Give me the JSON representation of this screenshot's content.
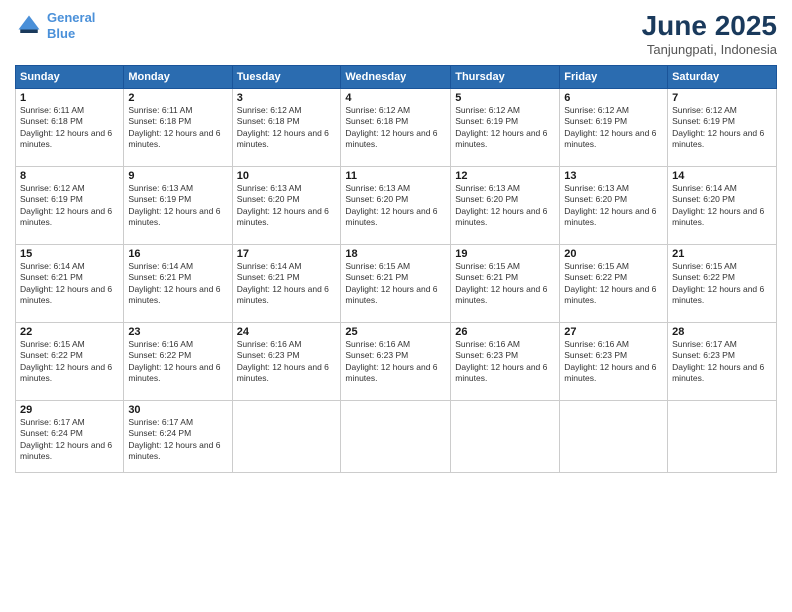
{
  "logo": {
    "line1": "General",
    "line2": "Blue"
  },
  "title": "June 2025",
  "subtitle": "Tanjungpati, Indonesia",
  "days_of_week": [
    "Sunday",
    "Monday",
    "Tuesday",
    "Wednesday",
    "Thursday",
    "Friday",
    "Saturday"
  ],
  "weeks": [
    [
      {
        "day": "1",
        "sunrise": "6:11 AM",
        "sunset": "6:18 PM",
        "daylight": "12 hours and 6 minutes."
      },
      {
        "day": "2",
        "sunrise": "6:11 AM",
        "sunset": "6:18 PM",
        "daylight": "12 hours and 6 minutes."
      },
      {
        "day": "3",
        "sunrise": "6:12 AM",
        "sunset": "6:18 PM",
        "daylight": "12 hours and 6 minutes."
      },
      {
        "day": "4",
        "sunrise": "6:12 AM",
        "sunset": "6:18 PM",
        "daylight": "12 hours and 6 minutes."
      },
      {
        "day": "5",
        "sunrise": "6:12 AM",
        "sunset": "6:19 PM",
        "daylight": "12 hours and 6 minutes."
      },
      {
        "day": "6",
        "sunrise": "6:12 AM",
        "sunset": "6:19 PM",
        "daylight": "12 hours and 6 minutes."
      },
      {
        "day": "7",
        "sunrise": "6:12 AM",
        "sunset": "6:19 PM",
        "daylight": "12 hours and 6 minutes."
      }
    ],
    [
      {
        "day": "8",
        "sunrise": "6:12 AM",
        "sunset": "6:19 PM",
        "daylight": "12 hours and 6 minutes."
      },
      {
        "day": "9",
        "sunrise": "6:13 AM",
        "sunset": "6:19 PM",
        "daylight": "12 hours and 6 minutes."
      },
      {
        "day": "10",
        "sunrise": "6:13 AM",
        "sunset": "6:20 PM",
        "daylight": "12 hours and 6 minutes."
      },
      {
        "day": "11",
        "sunrise": "6:13 AM",
        "sunset": "6:20 PM",
        "daylight": "12 hours and 6 minutes."
      },
      {
        "day": "12",
        "sunrise": "6:13 AM",
        "sunset": "6:20 PM",
        "daylight": "12 hours and 6 minutes."
      },
      {
        "day": "13",
        "sunrise": "6:13 AM",
        "sunset": "6:20 PM",
        "daylight": "12 hours and 6 minutes."
      },
      {
        "day": "14",
        "sunrise": "6:14 AM",
        "sunset": "6:20 PM",
        "daylight": "12 hours and 6 minutes."
      }
    ],
    [
      {
        "day": "15",
        "sunrise": "6:14 AM",
        "sunset": "6:21 PM",
        "daylight": "12 hours and 6 minutes."
      },
      {
        "day": "16",
        "sunrise": "6:14 AM",
        "sunset": "6:21 PM",
        "daylight": "12 hours and 6 minutes."
      },
      {
        "day": "17",
        "sunrise": "6:14 AM",
        "sunset": "6:21 PM",
        "daylight": "12 hours and 6 minutes."
      },
      {
        "day": "18",
        "sunrise": "6:15 AM",
        "sunset": "6:21 PM",
        "daylight": "12 hours and 6 minutes."
      },
      {
        "day": "19",
        "sunrise": "6:15 AM",
        "sunset": "6:21 PM",
        "daylight": "12 hours and 6 minutes."
      },
      {
        "day": "20",
        "sunrise": "6:15 AM",
        "sunset": "6:22 PM",
        "daylight": "12 hours and 6 minutes."
      },
      {
        "day": "21",
        "sunrise": "6:15 AM",
        "sunset": "6:22 PM",
        "daylight": "12 hours and 6 minutes."
      }
    ],
    [
      {
        "day": "22",
        "sunrise": "6:15 AM",
        "sunset": "6:22 PM",
        "daylight": "12 hours and 6 minutes."
      },
      {
        "day": "23",
        "sunrise": "6:16 AM",
        "sunset": "6:22 PM",
        "daylight": "12 hours and 6 minutes."
      },
      {
        "day": "24",
        "sunrise": "6:16 AM",
        "sunset": "6:23 PM",
        "daylight": "12 hours and 6 minutes."
      },
      {
        "day": "25",
        "sunrise": "6:16 AM",
        "sunset": "6:23 PM",
        "daylight": "12 hours and 6 minutes."
      },
      {
        "day": "26",
        "sunrise": "6:16 AM",
        "sunset": "6:23 PM",
        "daylight": "12 hours and 6 minutes."
      },
      {
        "day": "27",
        "sunrise": "6:16 AM",
        "sunset": "6:23 PM",
        "daylight": "12 hours and 6 minutes."
      },
      {
        "day": "28",
        "sunrise": "6:17 AM",
        "sunset": "6:23 PM",
        "daylight": "12 hours and 6 minutes."
      }
    ],
    [
      {
        "day": "29",
        "sunrise": "6:17 AM",
        "sunset": "6:24 PM",
        "daylight": "12 hours and 6 minutes."
      },
      {
        "day": "30",
        "sunrise": "6:17 AM",
        "sunset": "6:24 PM",
        "daylight": "12 hours and 6 minutes."
      },
      null,
      null,
      null,
      null,
      null
    ]
  ]
}
